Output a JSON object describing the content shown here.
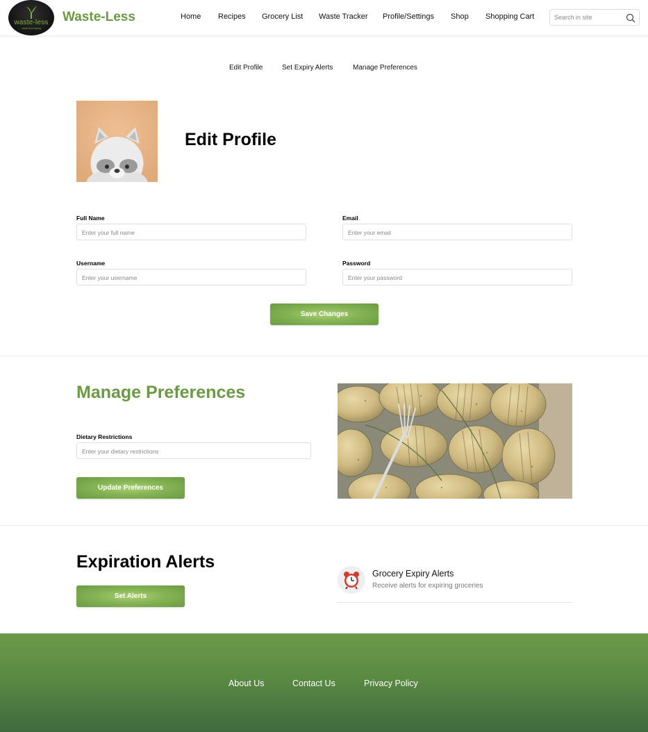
{
  "brand": {
    "name": "Waste-Less",
    "logo_word": "waste-less",
    "logo_tagline": "smart food saving"
  },
  "nav": {
    "items": [
      "Home",
      "Recipes",
      "Grocery List",
      "Waste Tracker",
      "Profile/Settings",
      "Shop",
      "Shopping Cart"
    ]
  },
  "search": {
    "placeholder": "Search in site",
    "icon": "search-icon"
  },
  "subnav": {
    "items": [
      "Edit Profile",
      "Set Expiry Alerts",
      "Manage Preferences"
    ]
  },
  "edit_profile": {
    "title": "Edit Profile",
    "full_name": {
      "label": "Full Name",
      "placeholder": "Enter your full name"
    },
    "email": {
      "label": "Email",
      "placeholder": "Enter your email"
    },
    "username": {
      "label": "Username",
      "placeholder": "Enter your username"
    },
    "password": {
      "label": "Password",
      "placeholder": "Enter your password"
    },
    "save_label": "Save Changes"
  },
  "preferences": {
    "title": "Manage Preferences",
    "dietary": {
      "label": "Dietary Restrictions",
      "placeholder": "Enter your dietary restrictions"
    },
    "update_label": "Update Preferences"
  },
  "expiration": {
    "title": "Expiration Alerts",
    "button_label": "Set Alerts",
    "card_title": "Grocery Expiry Alerts",
    "card_desc": "Receive alerts for expiring groceries",
    "card_icon": "alarm-clock-icon"
  },
  "footer": {
    "links": [
      "About Us",
      "Contact Us",
      "Privacy Policy"
    ]
  },
  "colors": {
    "brand_green": "#6a9a43",
    "button_green": "#86b454",
    "footer_top": "#6d9a48",
    "footer_bottom": "#3f6a3f",
    "alarm_red": "#d83a2c"
  }
}
